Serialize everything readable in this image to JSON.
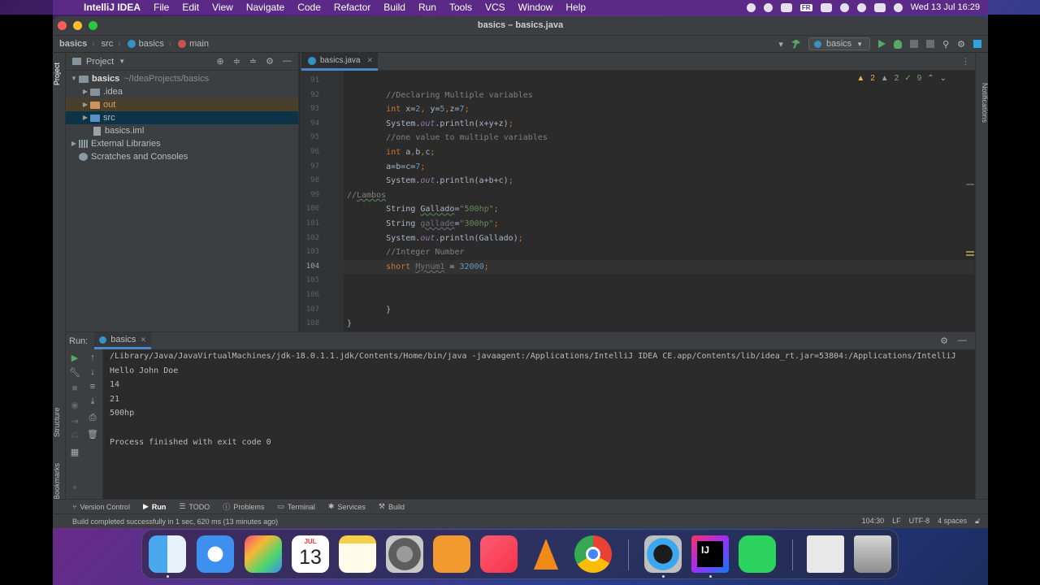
{
  "menubar": {
    "app_name": "IntelliJ IDEA",
    "items": [
      "File",
      "Edit",
      "View",
      "Navigate",
      "Code",
      "Refactor",
      "Build",
      "Run",
      "Tools",
      "VCS",
      "Window",
      "Help"
    ],
    "datetime": "Wed 13 Jul  16:29",
    "keyboard_layout": "FR"
  },
  "window": {
    "title": "basics – basics.java"
  },
  "navbar": {
    "breadcrumbs": [
      "basics",
      "src",
      "basics",
      "main"
    ],
    "run_config": "basics"
  },
  "project_panel": {
    "title": "Project",
    "tree": [
      {
        "label": "basics",
        "path": "~/IdeaProjects/basics",
        "level": 0,
        "expanded": true,
        "icon": "folder"
      },
      {
        "label": ".idea",
        "level": 1,
        "expanded": false,
        "icon": "folder"
      },
      {
        "label": "out",
        "level": 1,
        "expanded": false,
        "icon": "folder-orange"
      },
      {
        "label": "src",
        "level": 1,
        "expanded": false,
        "icon": "folder-blue"
      },
      {
        "label": "basics.iml",
        "level": 1,
        "icon": "iml-file"
      },
      {
        "label": "External Libraries",
        "level": 0,
        "expanded": false,
        "icon": "library"
      },
      {
        "label": "Scratches and Consoles",
        "level": 0,
        "icon": "scratch"
      }
    ]
  },
  "editor": {
    "tab": "basics.java",
    "inspections": {
      "warnings": "2",
      "weak_warnings": "2",
      "ok": "9"
    },
    "lines": [
      {
        "n": "91",
        "code": ""
      },
      {
        "n": "92",
        "code": "        //Declaring Multiple variables"
      },
      {
        "n": "93",
        "code": "        int x=2, y=5,z=7;"
      },
      {
        "n": "94",
        "code": "        System.out.println(x+y+z);"
      },
      {
        "n": "95",
        "code": "        //one value to multiple variables"
      },
      {
        "n": "96",
        "code": "        int a,b,c;"
      },
      {
        "n": "97",
        "code": "        a=b=c=7;"
      },
      {
        "n": "98",
        "code": "        System.out.println(a+b+c);"
      },
      {
        "n": "99",
        "code": "//Lambos"
      },
      {
        "n": "100",
        "code": "        String Gallado=\"500hp\";"
      },
      {
        "n": "101",
        "code": "        String gallade=\"300hp\";"
      },
      {
        "n": "102",
        "code": "        System.out.println(Gallado);"
      },
      {
        "n": "103",
        "code": "        //Integer Number"
      },
      {
        "n": "104",
        "code": "        short Mynum1 = 32000;"
      },
      {
        "n": "105",
        "code": ""
      },
      {
        "n": "106",
        "code": ""
      },
      {
        "n": "107",
        "code": "        }"
      },
      {
        "n": "108",
        "code": "}"
      }
    ],
    "current_line": "104"
  },
  "run_panel": {
    "label": "Run:",
    "tab": "basics",
    "output": [
      "/Library/Java/JavaVirtualMachines/jdk-18.0.1.1.jdk/Contents/Home/bin/java -javaagent:/Applications/IntelliJ IDEA CE.app/Contents/lib/idea_rt.jar=53804:/Applications/IntelliJ",
      "Hello John Doe",
      "14",
      "21",
      "500hp",
      "",
      "Process finished with exit code 0"
    ]
  },
  "bottom_tabs": [
    "Version Control",
    "Run",
    "TODO",
    "Problems",
    "Terminal",
    "Services",
    "Build"
  ],
  "side_tabs": {
    "left": [
      "Project",
      "Structure",
      "Bookmarks"
    ],
    "right": [
      "Notifications"
    ]
  },
  "status_bar": {
    "message": "Build completed successfully in 1 sec, 620 ms (13 minutes ago)",
    "position": "104:30",
    "line_sep": "LF",
    "encoding": "UTF-8",
    "indent": "4 spaces"
  },
  "dock": {
    "calendar_month": "JUL",
    "calendar_day": "13",
    "apps": [
      "Finder",
      "Safari",
      "Launchpad",
      "Calendar",
      "Notes",
      "System Preferences",
      "Books",
      "Music",
      "VLC",
      "Chrome",
      "QuickTime",
      "IntelliJ IDEA",
      "WhatsApp",
      "Music file",
      "Trash"
    ],
    "ij_label": "IJ"
  }
}
